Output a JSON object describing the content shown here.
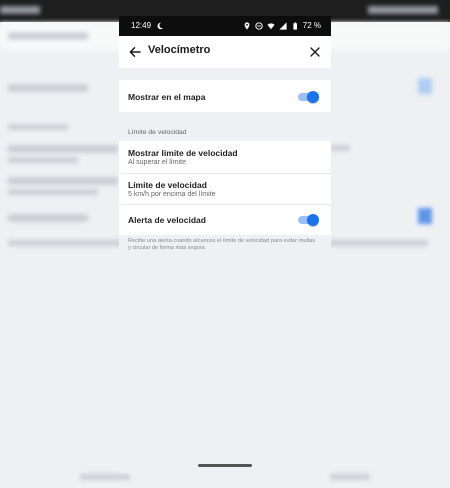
{
  "status_bar": {
    "time": "12:49",
    "battery": "72 %",
    "icons": [
      "moon-icon",
      "location-icon",
      "dnd-icon",
      "wifi-icon",
      "signal-icon",
      "battery-icon"
    ]
  },
  "app_bar": {
    "title": "Velocímetro",
    "back_icon": "arrow-left",
    "close_icon": "close"
  },
  "settings": {
    "show_on_map": {
      "label": "Mostrar en el mapa",
      "enabled": true
    },
    "section_label": "Límite de velocidad",
    "show_speed_limit": {
      "label": "Mostrar límite de velocidad",
      "value": "Al superar el límite"
    },
    "speed_limit": {
      "label": "Límite de velocidad",
      "value": "5 km/h por encima del límite"
    },
    "speed_alert": {
      "label": "Alerta de velocidad",
      "enabled": true
    },
    "footer": "Recibe una alerta cuando alcances el límite de velocidad para evitar multas y circular de forma más segura"
  },
  "colors": {
    "accent": "#1a73e8",
    "track": "#9cc0f3",
    "background": "#eef0f4"
  }
}
